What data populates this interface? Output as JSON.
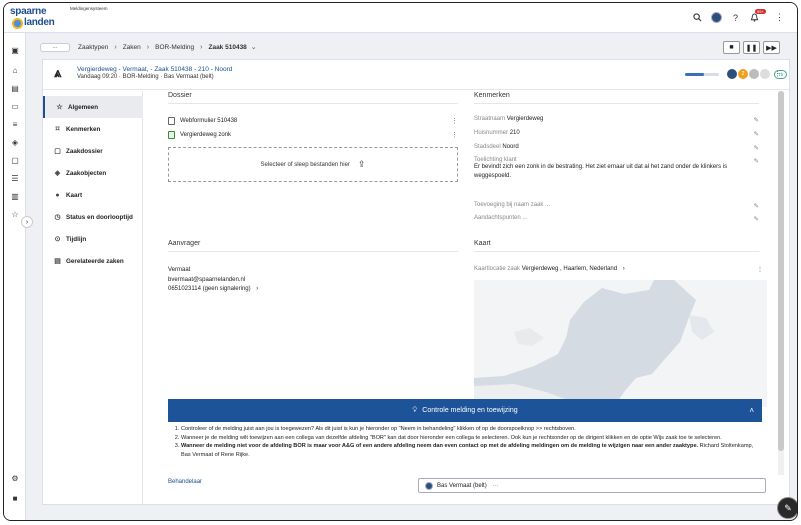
{
  "app": {
    "logo_line1": "spaarne",
    "logo_line2": "landen",
    "name": "Meldingensysteem"
  },
  "topbar": {
    "notification_count": "99+",
    "icons": [
      "search-icon",
      "avatar",
      "help-icon",
      "bell-icon",
      "more-icon"
    ]
  },
  "breadcrumb": {
    "ellipsis": "...",
    "items": [
      "Zaaktypen",
      "Zaken",
      "BOR-Melding",
      "Zaak 510438"
    ]
  },
  "case": {
    "title": "Vergierdeweg - Vermaat, - Zaak 510438 - 210 - Noord",
    "subtitle": "Vandaag 09:20 · BOR-Melding · Bas Vermaat (belt)",
    "progress": 0.55,
    "badge_number": "2",
    "status_pill": "Tb"
  },
  "nav": {
    "items": [
      {
        "label": "Algemeen",
        "icon": "star-icon"
      },
      {
        "label": "Kenmerken",
        "icon": "tag-icon"
      },
      {
        "label": "Zaakdossier",
        "icon": "folder-icon"
      },
      {
        "label": "Zaakobjecten",
        "icon": "cube-icon"
      },
      {
        "label": "Kaart",
        "icon": "globe-icon"
      },
      {
        "label": "Status en doorlooptijd",
        "icon": "clock-icon"
      },
      {
        "label": "Tijdlijn",
        "icon": "timeline-icon"
      },
      {
        "label": "Gerelateerde zaken",
        "icon": "link-icon"
      }
    ]
  },
  "dossier": {
    "heading": "Dossier",
    "files": [
      {
        "name": "Webformulier 510438",
        "type": "doc"
      },
      {
        "name": "Vergierdeweg zonk",
        "type": "image"
      }
    ],
    "upload_label": "Selecteer of sleep bestanden hier"
  },
  "kenmerken": {
    "heading": "Kenmerken",
    "straatnaam_k": "Straatnaam",
    "straatnaam_v": "Vergierdeweg",
    "huisnummer_k": "Huisnummer",
    "huisnummer_v": "210",
    "stadsdeel_k": "Stadsdeel",
    "stadsdeel_v": "Noord",
    "toelichting_k": "Toelichting klant",
    "toelichting_v": "Er bevindt zich een zonk in de bestrating. Het ziet ernaar uit dat al het zand onder de klinkers is weggespoeld.",
    "toevoeging_k": "Toevoeging bij naam zaak ...",
    "aandacht_k": "Aandachtspunten ..."
  },
  "aanvrager": {
    "heading": "Aanvrager",
    "name": "Vermaat",
    "email": "bvermaat@spaarnelanden.nl",
    "phone": "0651023114 (geen signalering)"
  },
  "kaart": {
    "heading": "Kaart",
    "location_label": "Kaartlocatie zaak",
    "location_value": "Vergierdeweg , Haarlem, Nederland"
  },
  "notice": {
    "title": "Controle melding en toewijzing",
    "item1": "Controleer of de melding juist aan jou is toegewezen? Als dit juist is kun je hieronder op \"Neem in behandeling\" klikken of op de doorspoelknop >> rechtsboven.",
    "item2": "Wanneer je de melding wilt toewijzen aan een collega van dezelfde afdeling \"BOR\" kan dat door hieronder een collega te selecteren. Ook kun je rechtsonder op de dirigent klikken en de optie Wijs zaak toe te selecteren.",
    "item3_bold": "Wanneer de melding niet voor de afdeling BOR is maar voor A&G of een andere afdeling neem dan even contact op met de afdeling meldingen om de melding te wijzigen naar een ander zaaktype.",
    "item3_rest": " Richard Stoltenkamp, Bas Vermaat of Rene Rijke."
  },
  "behandelaar": {
    "label": "Behandelaar",
    "value": "Bas Vermaat (belt)",
    "suffix": "···"
  },
  "colors": {
    "brand": "#1d4e8f",
    "notice": "#1d5499",
    "badge_orange": "#f0a020",
    "badge_red": "#d32f2f"
  }
}
